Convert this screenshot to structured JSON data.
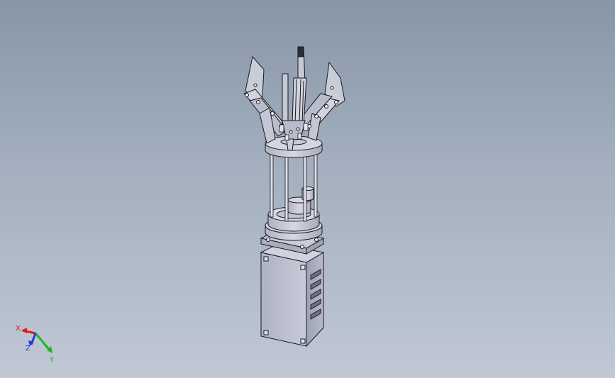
{
  "viewport": {
    "background_top": "#8796a8",
    "background_bottom": "#c0c8d4"
  },
  "model": {
    "part_color": "#c4c7d6",
    "edge_color": "#1a1a1a"
  },
  "triad": {
    "x_label": "X",
    "y_label": "Y",
    "z_label": "Z",
    "x_color": "#e01b1b",
    "y_color": "#18b818",
    "z_color": "#1b3fd9"
  }
}
